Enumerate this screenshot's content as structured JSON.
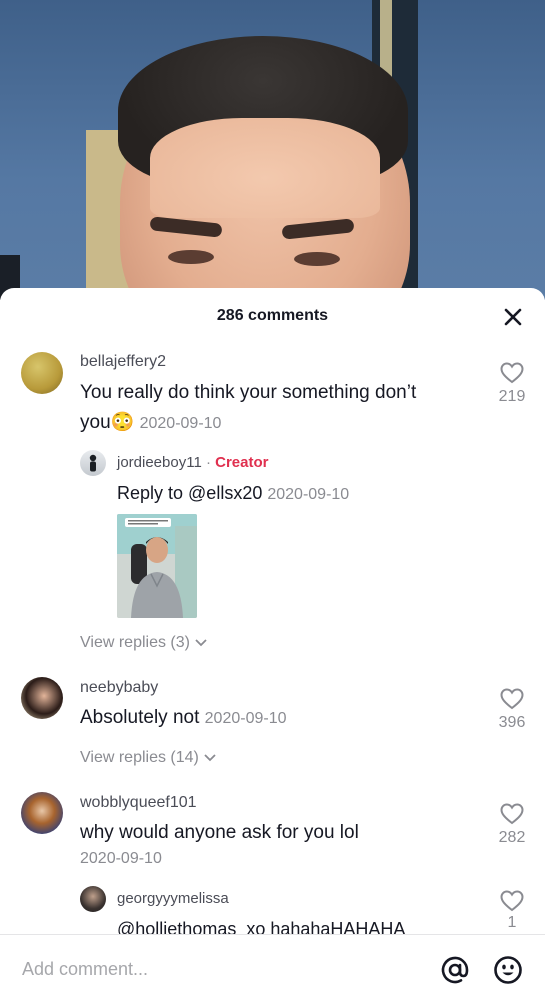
{
  "header": {
    "comment_count": "286 comments",
    "close_icon": "close-icon"
  },
  "comments": [
    {
      "username": "bellajeffery2",
      "text": "You really do think your something don’t",
      "text_line2": "you",
      "emoji": "😳",
      "date": "2020-09-10",
      "likes": "219",
      "view_replies": "View replies (3)",
      "reply": {
        "username": "jordieeboy11",
        "separator": "·",
        "tag": "Creator",
        "text": "Reply to @ellsx20",
        "date": "2020-09-10"
      }
    },
    {
      "username": "neebybaby",
      "text": "Absolutely not",
      "date": "2020-09-10",
      "likes": "396",
      "view_replies": "View replies (14)"
    },
    {
      "username": "wobblyqueef101",
      "text": "why would anyone ask for you lol",
      "date": "2020-09-10",
      "likes": "282"
    },
    {
      "username": "georgyyymelissa",
      "text": "@holliethomas_xo hahahaHAHAHA",
      "likes": "1"
    }
  ],
  "input": {
    "placeholder": "Add comment..."
  },
  "colors": {
    "creator": "#e0304f",
    "muted": "#8a8b91",
    "text": "#161823"
  }
}
